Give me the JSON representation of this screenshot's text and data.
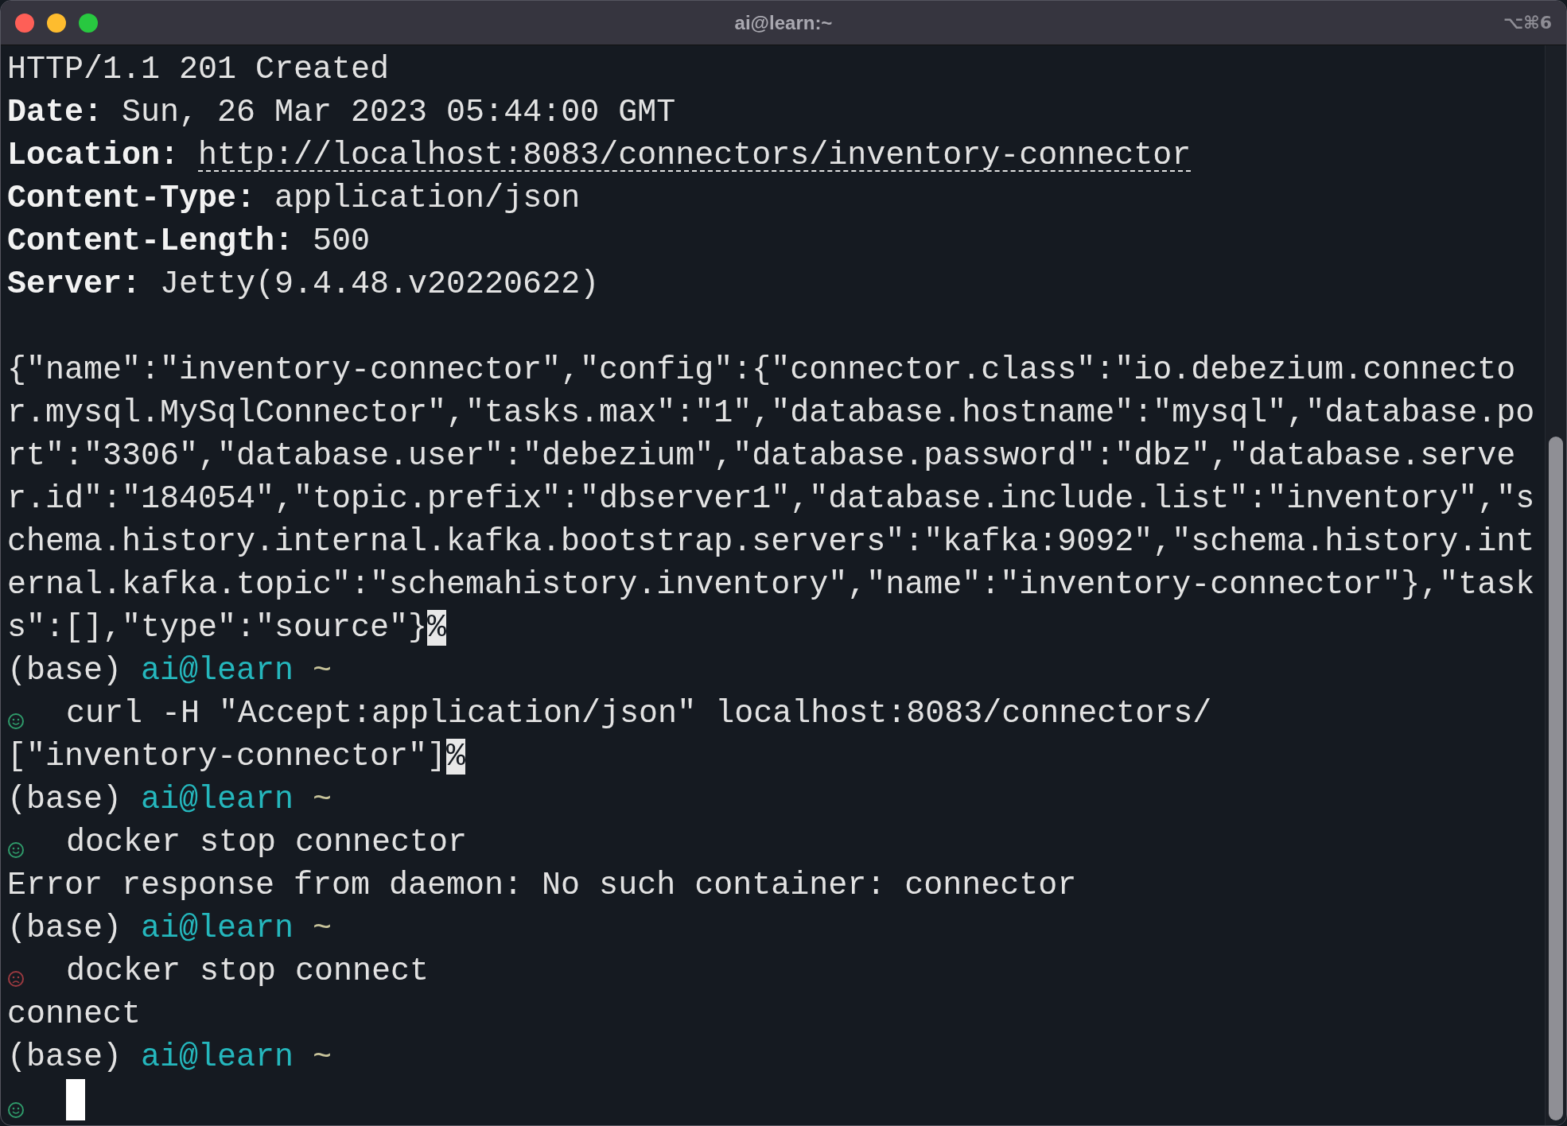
{
  "window": {
    "title": "ai@learn:~",
    "shortcut": "⌥⌘6"
  },
  "lines": [
    {
      "kind": "plain",
      "text": "HTTP/1.1 201 Created"
    },
    {
      "kind": "header",
      "key": "Date:",
      "value": "Sun, 26 Mar 2023 05:44:00 GMT"
    },
    {
      "kind": "link_header",
      "key": "Location:",
      "value": "http://localhost:8083/connectors/inventory-connector"
    },
    {
      "kind": "header",
      "key": "Content-Type:",
      "value": "application/json"
    },
    {
      "kind": "header",
      "key": "Content-Length:",
      "value": "500"
    },
    {
      "kind": "header",
      "key": "Server:",
      "value": "Jetty(9.4.48.v20220622)"
    },
    {
      "kind": "blank"
    },
    {
      "kind": "plain",
      "text": "{\"name\":\"inventory-connector\",\"config\":{\"connector.class\":\"io.debezium.connector.mysql.MySqlConnector\",\"tasks.max\":\"1\",\"database.hostname\":\"mysql\",\"database.port\":\"3306\",\"database.user\":\"debezium\",\"database.password\":\"dbz\",\"database.server.id\":\"184054\",\"topic.prefix\":\"dbserver1\",\"database.include.list\":\"inventory\",\"schema.history.internal.kafka.bootstrap.servers\":\"kafka:9092\",\"schema.history.internal.kafka.topic\":\"schemahistory.inventory\",\"name\":\"inventory-connector\"},\"tasks\":[],\"type\":\"source\"}",
      "no_newline": "%"
    },
    {
      "kind": "prompt",
      "env": "(base)",
      "host": "ai@learn",
      "dir": "~"
    },
    {
      "kind": "command",
      "ok": true,
      "text": "curl -H \"Accept:application/json\" localhost:8083/connectors/"
    },
    {
      "kind": "plain",
      "text": "[\"inventory-connector\"]",
      "no_newline": "%"
    },
    {
      "kind": "prompt",
      "env": "(base)",
      "host": "ai@learn",
      "dir": "~"
    },
    {
      "kind": "command",
      "ok": true,
      "text": "docker stop connector"
    },
    {
      "kind": "plain",
      "text": "Error response from daemon: No such container: connector"
    },
    {
      "kind": "prompt",
      "env": "(base)",
      "host": "ai@learn",
      "dir": "~"
    },
    {
      "kind": "command",
      "ok": false,
      "text": "docker stop connect"
    },
    {
      "kind": "plain",
      "text": "connect"
    },
    {
      "kind": "prompt",
      "env": "(base)",
      "host": "ai@learn",
      "dir": "~"
    },
    {
      "kind": "input",
      "ok": true
    }
  ]
}
